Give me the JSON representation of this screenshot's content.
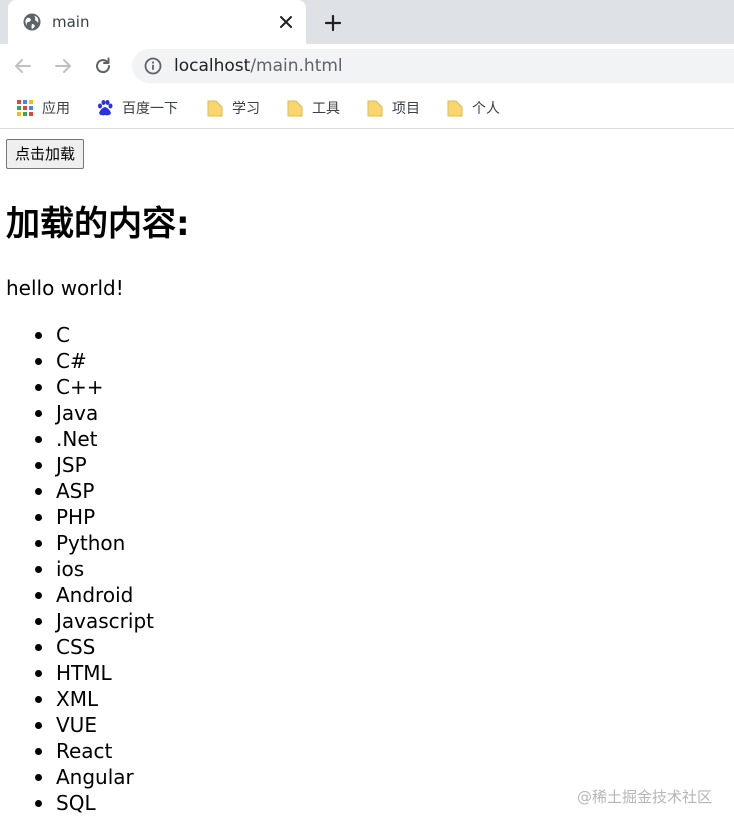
{
  "tab": {
    "title": "main",
    "close_glyph": "✕",
    "new_tab_glyph": "+"
  },
  "omnibox": {
    "host": "localhost",
    "path": "/main.html"
  },
  "bookmarks": [
    {
      "label": "应用",
      "icon": "apps-grid-icon"
    },
    {
      "label": "百度一下",
      "icon": "baidu-paw-icon"
    },
    {
      "label": "学习",
      "icon": "folder-icon"
    },
    {
      "label": "工具",
      "icon": "folder-icon"
    },
    {
      "label": "项目",
      "icon": "folder-icon"
    },
    {
      "label": "个人",
      "icon": "folder-icon"
    }
  ],
  "page": {
    "button_label": "点击加载",
    "heading": "加载的内容:",
    "text": "hello world!",
    "items": [
      "C",
      "C#",
      "C++",
      "Java",
      ".Net",
      "JSP",
      "ASP",
      "PHP",
      "Python",
      "ios",
      "Android",
      "Javascript",
      "CSS",
      "HTML",
      "XML",
      "VUE",
      "React",
      "Angular",
      "SQL"
    ]
  },
  "watermark": "@稀土掘金技术社区",
  "colors": {
    "tabstrip": "#dee1e6",
    "omnibox": "#f1f3f4",
    "folder": "#f9d56e"
  }
}
